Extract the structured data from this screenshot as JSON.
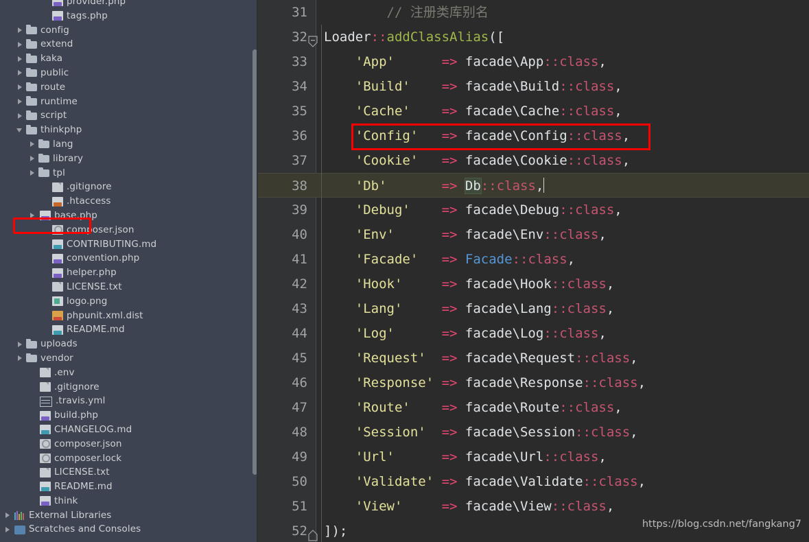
{
  "sidebar": {
    "scrollbar": {
      "name": "project-tree-scrollbar"
    },
    "items": [
      {
        "label": "provider.php",
        "indent": 3,
        "arrow": "none",
        "icon": "php-file-icon"
      },
      {
        "label": "tags.php",
        "indent": 3,
        "arrow": "none",
        "icon": "php-file-icon"
      },
      {
        "label": "config",
        "indent": 1,
        "arrow": "collapsed",
        "icon": "folder-icon"
      },
      {
        "label": "extend",
        "indent": 1,
        "arrow": "collapsed",
        "icon": "folder-icon"
      },
      {
        "label": "kaka",
        "indent": 1,
        "arrow": "collapsed",
        "icon": "folder-icon"
      },
      {
        "label": "public",
        "indent": 1,
        "arrow": "collapsed",
        "icon": "folder-icon"
      },
      {
        "label": "route",
        "indent": 1,
        "arrow": "collapsed",
        "icon": "folder-icon"
      },
      {
        "label": "runtime",
        "indent": 1,
        "arrow": "collapsed",
        "icon": "folder-icon"
      },
      {
        "label": "script",
        "indent": 1,
        "arrow": "collapsed",
        "icon": "folder-icon"
      },
      {
        "label": "thinkphp",
        "indent": 1,
        "arrow": "expanded",
        "icon": "folder-icon"
      },
      {
        "label": "lang",
        "indent": 2,
        "arrow": "collapsed",
        "icon": "folder-icon"
      },
      {
        "label": "library",
        "indent": 2,
        "arrow": "collapsed",
        "icon": "folder-icon"
      },
      {
        "label": "tpl",
        "indent": 2,
        "arrow": "collapsed",
        "icon": "folder-icon"
      },
      {
        "label": ".gitignore",
        "indent": 3,
        "arrow": "none",
        "icon": "text-file-icon"
      },
      {
        "label": ".htaccess",
        "indent": 3,
        "arrow": "none",
        "icon": "htaccess-file-icon"
      },
      {
        "label": "base.php",
        "indent": 2,
        "arrow": "collapsed",
        "icon": "php-file-icon"
      },
      {
        "label": "composer.json",
        "indent": 3,
        "arrow": "none",
        "icon": "json-file-icon"
      },
      {
        "label": "CONTRIBUTING.md",
        "indent": 3,
        "arrow": "none",
        "icon": "markdown-file-icon"
      },
      {
        "label": "convention.php",
        "indent": 3,
        "arrow": "none",
        "icon": "php-file-icon"
      },
      {
        "label": "helper.php",
        "indent": 3,
        "arrow": "none",
        "icon": "php-file-icon"
      },
      {
        "label": "LICENSE.txt",
        "indent": 3,
        "arrow": "none",
        "icon": "text-file-icon"
      },
      {
        "label": "logo.png",
        "indent": 3,
        "arrow": "none",
        "icon": "image-file-icon"
      },
      {
        "label": "phpunit.xml.dist",
        "indent": 3,
        "arrow": "none",
        "icon": "xml-file-icon"
      },
      {
        "label": "README.md",
        "indent": 3,
        "arrow": "none",
        "icon": "markdown-file-icon"
      },
      {
        "label": "uploads",
        "indent": 1,
        "arrow": "collapsed",
        "icon": "folder-icon"
      },
      {
        "label": "vendor",
        "indent": 1,
        "arrow": "collapsed",
        "icon": "folder-icon"
      },
      {
        "label": ".env",
        "indent": 2,
        "arrow": "none",
        "icon": "text-file-icon"
      },
      {
        "label": ".gitignore",
        "indent": 2,
        "arrow": "none",
        "icon": "text-file-icon"
      },
      {
        "label": ".travis.yml",
        "indent": 2,
        "arrow": "none",
        "icon": "yml-file-icon"
      },
      {
        "label": "build.php",
        "indent": 2,
        "arrow": "none",
        "icon": "php-file-icon"
      },
      {
        "label": "CHANGELOG.md",
        "indent": 2,
        "arrow": "none",
        "icon": "markdown-file-icon"
      },
      {
        "label": "composer.json",
        "indent": 2,
        "arrow": "none",
        "icon": "json-file-icon"
      },
      {
        "label": "composer.lock",
        "indent": 2,
        "arrow": "none",
        "icon": "json-file-icon"
      },
      {
        "label": "LICENSE.txt",
        "indent": 2,
        "arrow": "none",
        "icon": "text-file-icon"
      },
      {
        "label": "README.md",
        "indent": 2,
        "arrow": "none",
        "icon": "markdown-file-icon"
      },
      {
        "label": "think",
        "indent": 2,
        "arrow": "none",
        "icon": "php-file-icon"
      },
      {
        "label": "External Libraries",
        "indent": 0,
        "arrow": "collapsed",
        "icon": "external-libraries-icon"
      },
      {
        "label": "Scratches and Consoles",
        "indent": 0,
        "arrow": "collapsed",
        "icon": "scratches-icon"
      }
    ]
  },
  "editor": {
    "highlighted_line": 38,
    "caret_line": 38,
    "caret_after_text": "Db::class,",
    "lines": [
      {
        "num": "31",
        "fold": "",
        "tokens": [
          {
            "t": "        ",
            "c": "t-plain"
          },
          {
            "t": "// 注册类库别名",
            "c": "t-comment"
          }
        ]
      },
      {
        "num": "32",
        "fold": "minus",
        "tokens": [
          {
            "t": "Loader",
            "c": "t-plain"
          },
          {
            "t": "::",
            "c": "t-op"
          },
          {
            "t": "addClassAlias",
            "c": "t-fn"
          },
          {
            "t": "([",
            "c": "t-punc"
          }
        ]
      },
      {
        "num": "33",
        "fold": "",
        "tokens": [
          {
            "t": "    'App'      ",
            "c": "t-str"
          },
          {
            "t": "=> ",
            "c": "t-arrow"
          },
          {
            "t": "facade\\App",
            "c": "t-plain"
          },
          {
            "t": "::class",
            "c": "t-cls"
          },
          {
            "t": ",",
            "c": "t-punc"
          }
        ]
      },
      {
        "num": "34",
        "fold": "",
        "tokens": [
          {
            "t": "    'Build'    ",
            "c": "t-str"
          },
          {
            "t": "=> ",
            "c": "t-arrow"
          },
          {
            "t": "facade\\Build",
            "c": "t-plain"
          },
          {
            "t": "::class",
            "c": "t-cls"
          },
          {
            "t": ",",
            "c": "t-punc"
          }
        ]
      },
      {
        "num": "35",
        "fold": "",
        "tokens": [
          {
            "t": "    'Cache'    ",
            "c": "t-str"
          },
          {
            "t": "=> ",
            "c": "t-arrow"
          },
          {
            "t": "facade\\Cache",
            "c": "t-plain"
          },
          {
            "t": "::class",
            "c": "t-cls"
          },
          {
            "t": ",",
            "c": "t-punc"
          }
        ]
      },
      {
        "num": "36",
        "fold": "",
        "tokens": [
          {
            "t": "    'Config'   ",
            "c": "t-str"
          },
          {
            "t": "=> ",
            "c": "t-arrow"
          },
          {
            "t": "facade\\Config",
            "c": "t-plain"
          },
          {
            "t": "::class",
            "c": "t-cls"
          },
          {
            "t": ",",
            "c": "t-punc"
          }
        ]
      },
      {
        "num": "37",
        "fold": "",
        "tokens": [
          {
            "t": "    'Cookie'   ",
            "c": "t-str"
          },
          {
            "t": "=> ",
            "c": "t-arrow"
          },
          {
            "t": "facade\\Cookie",
            "c": "t-plain"
          },
          {
            "t": "::class",
            "c": "t-cls"
          },
          {
            "t": ",",
            "c": "t-punc"
          }
        ]
      },
      {
        "num": "38",
        "fold": "",
        "tokens": [
          {
            "t": "    'Db'       ",
            "c": "t-str"
          },
          {
            "t": "=> ",
            "c": "t-arrow"
          },
          {
            "t": "Db",
            "c": "t-ident caret-ident"
          },
          {
            "t": "::class",
            "c": "t-cls"
          },
          {
            "t": ",",
            "c": "t-punc"
          }
        ]
      },
      {
        "num": "39",
        "fold": "",
        "tokens": [
          {
            "t": "    'Debug'    ",
            "c": "t-str"
          },
          {
            "t": "=> ",
            "c": "t-arrow"
          },
          {
            "t": "facade\\Debug",
            "c": "t-plain"
          },
          {
            "t": "::class",
            "c": "t-cls"
          },
          {
            "t": ",",
            "c": "t-punc"
          }
        ]
      },
      {
        "num": "40",
        "fold": "",
        "tokens": [
          {
            "t": "    'Env'      ",
            "c": "t-str"
          },
          {
            "t": "=> ",
            "c": "t-arrow"
          },
          {
            "t": "facade\\Env",
            "c": "t-plain"
          },
          {
            "t": "::class",
            "c": "t-cls"
          },
          {
            "t": ",",
            "c": "t-punc"
          }
        ]
      },
      {
        "num": "41",
        "fold": "",
        "tokens": [
          {
            "t": "    'Facade'   ",
            "c": "t-str"
          },
          {
            "t": "=> ",
            "c": "t-arrow"
          },
          {
            "t": "Facade",
            "c": "t-facade"
          },
          {
            "t": "::class",
            "c": "t-cls"
          },
          {
            "t": ",",
            "c": "t-punc"
          }
        ]
      },
      {
        "num": "42",
        "fold": "",
        "tokens": [
          {
            "t": "    'Hook'     ",
            "c": "t-str"
          },
          {
            "t": "=> ",
            "c": "t-arrow"
          },
          {
            "t": "facade\\Hook",
            "c": "t-plain"
          },
          {
            "t": "::class",
            "c": "t-cls"
          },
          {
            "t": ",",
            "c": "t-punc"
          }
        ]
      },
      {
        "num": "43",
        "fold": "",
        "tokens": [
          {
            "t": "    'Lang'     ",
            "c": "t-str"
          },
          {
            "t": "=> ",
            "c": "t-arrow"
          },
          {
            "t": "facade\\Lang",
            "c": "t-plain"
          },
          {
            "t": "::class",
            "c": "t-cls"
          },
          {
            "t": ",",
            "c": "t-punc"
          }
        ]
      },
      {
        "num": "44",
        "fold": "",
        "tokens": [
          {
            "t": "    'Log'      ",
            "c": "t-str"
          },
          {
            "t": "=> ",
            "c": "t-arrow"
          },
          {
            "t": "facade\\Log",
            "c": "t-plain"
          },
          {
            "t": "::class",
            "c": "t-cls"
          },
          {
            "t": ",",
            "c": "t-punc"
          }
        ]
      },
      {
        "num": "45",
        "fold": "",
        "tokens": [
          {
            "t": "    'Request'  ",
            "c": "t-str"
          },
          {
            "t": "=> ",
            "c": "t-arrow"
          },
          {
            "t": "facade\\Request",
            "c": "t-plain"
          },
          {
            "t": "::class",
            "c": "t-cls"
          },
          {
            "t": ",",
            "c": "t-punc"
          }
        ]
      },
      {
        "num": "46",
        "fold": "",
        "tokens": [
          {
            "t": "    'Response' ",
            "c": "t-str"
          },
          {
            "t": "=> ",
            "c": "t-arrow"
          },
          {
            "t": "facade\\Response",
            "c": "t-plain"
          },
          {
            "t": "::class",
            "c": "t-cls"
          },
          {
            "t": ",",
            "c": "t-punc"
          }
        ]
      },
      {
        "num": "47",
        "fold": "",
        "tokens": [
          {
            "t": "    'Route'    ",
            "c": "t-str"
          },
          {
            "t": "=> ",
            "c": "t-arrow"
          },
          {
            "t": "facade\\Route",
            "c": "t-plain"
          },
          {
            "t": "::class",
            "c": "t-cls"
          },
          {
            "t": ",",
            "c": "t-punc"
          }
        ]
      },
      {
        "num": "48",
        "fold": "",
        "tokens": [
          {
            "t": "    'Session'  ",
            "c": "t-str"
          },
          {
            "t": "=> ",
            "c": "t-arrow"
          },
          {
            "t": "facade\\Session",
            "c": "t-plain"
          },
          {
            "t": "::class",
            "c": "t-cls"
          },
          {
            "t": ",",
            "c": "t-punc"
          }
        ]
      },
      {
        "num": "49",
        "fold": "",
        "tokens": [
          {
            "t": "    'Url'      ",
            "c": "t-str"
          },
          {
            "t": "=> ",
            "c": "t-arrow"
          },
          {
            "t": "facade\\Url",
            "c": "t-plain"
          },
          {
            "t": "::class",
            "c": "t-cls"
          },
          {
            "t": ",",
            "c": "t-punc"
          }
        ]
      },
      {
        "num": "50",
        "fold": "",
        "tokens": [
          {
            "t": "    'Validate' ",
            "c": "t-str"
          },
          {
            "t": "=> ",
            "c": "t-arrow"
          },
          {
            "t": "facade\\Validate",
            "c": "t-plain"
          },
          {
            "t": "::class",
            "c": "t-cls"
          },
          {
            "t": ",",
            "c": "t-punc"
          }
        ]
      },
      {
        "num": "51",
        "fold": "",
        "tokens": [
          {
            "t": "    'View'     ",
            "c": "t-str"
          },
          {
            "t": "=> ",
            "c": "t-arrow"
          },
          {
            "t": "facade\\View",
            "c": "t-plain"
          },
          {
            "t": "::class",
            "c": "t-cls"
          },
          {
            "t": ",",
            "c": "t-punc"
          }
        ]
      },
      {
        "num": "52",
        "fold": "plus",
        "tokens": [
          {
            "t": "]);",
            "c": "t-punc"
          }
        ]
      }
    ]
  },
  "annotations": {
    "config_box_color": "#ff0000",
    "basephp_box_color": "#ff0000"
  },
  "watermark": {
    "text": "https://blog.csdn.net/fangkang7"
  },
  "colors": {
    "sidebar_bg": "#3d4350",
    "gutter_bg": "#313335",
    "editor_bg": "#2b2b2b",
    "current_line_bg": "#3b3b2f",
    "string": "#e3e09a",
    "class_ref": "#c75470",
    "arrow_op": "#e8476f",
    "comment": "#7a7a70",
    "function": "#9fb84a",
    "annotation_red": "#ff0000"
  }
}
